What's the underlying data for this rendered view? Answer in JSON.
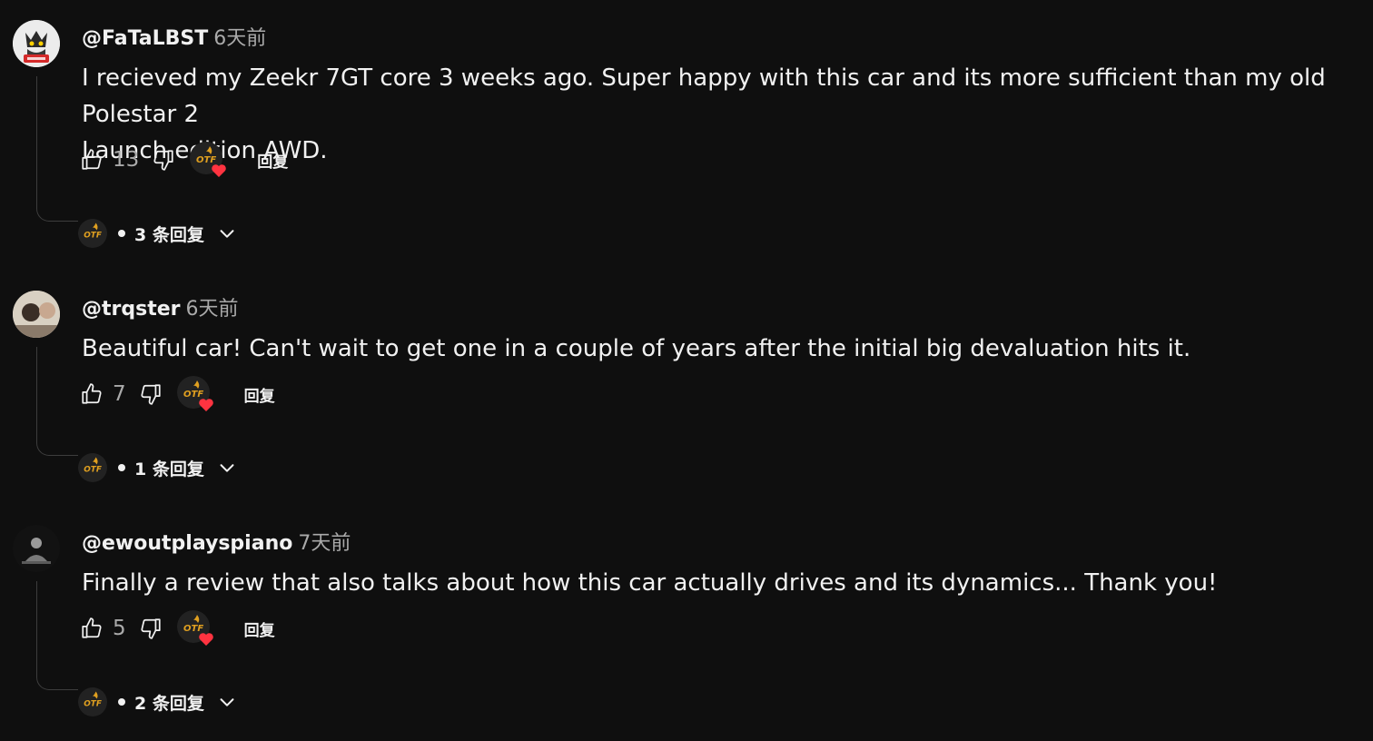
{
  "comments": [
    {
      "handle": "@FaTaLBST",
      "time": "6天前",
      "text": "I recieved my Zeekr 7GT core 3 weeks ago. Super happy with this car and its more sufficient than my old Polestar 2\nLaunch edition AWD.",
      "likes": "13",
      "reply_label": "回复",
      "replies_label": "3 条回复",
      "avatar_icon": "avatar-anime-character"
    },
    {
      "handle": "@trqster",
      "time": "6天前",
      "text": "Beautiful car! Can't wait to get one in a couple of years after the initial big devaluation hits it.",
      "likes": "7",
      "reply_label": "回复",
      "replies_label": "1 条回复",
      "avatar_icon": "avatar-photo"
    },
    {
      "handle": "@ewoutplayspiano",
      "time": "7天前",
      "text": "Finally a review that also talks about how this car actually drives and its dynamics... Thank you!",
      "likes": "5",
      "reply_label": "回复",
      "replies_label": "2 条回复",
      "avatar_icon": "avatar-photo-dark"
    }
  ],
  "creator_logo": "OTF",
  "colors": {
    "background": "#0f0f0f",
    "text": "#f1f1f1",
    "secondary": "#aaaaaa",
    "heart": "#ff3340",
    "logo_gold": "#e0a020"
  }
}
